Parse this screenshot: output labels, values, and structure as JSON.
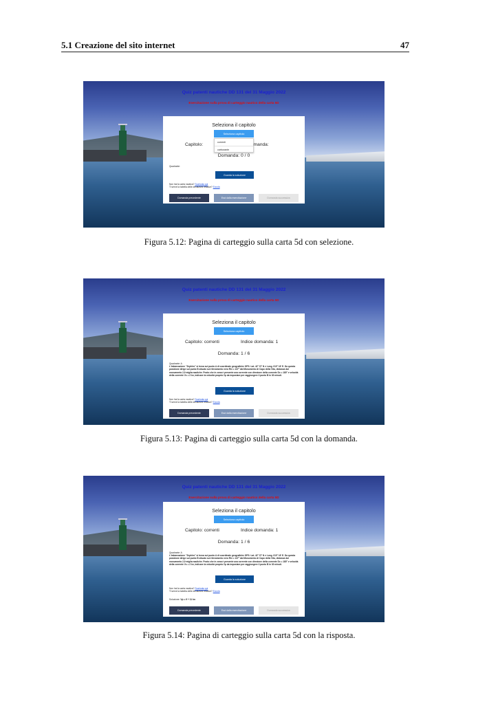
{
  "page": {
    "section": "5.1 Creazione del sito internet",
    "number": "47"
  },
  "app": {
    "title": "Quiz patenti nautiche DD 131 del 31 Maggio 2022",
    "subtitle": "Esercitazione sulla prova di carteggio nautico della carta 5D",
    "panel_title": "Seleziona il capitolo",
    "select_button": "Seleziona capitolo",
    "answer_button": "Guarda la soluzione",
    "help_line1": "Non hai la carta nautica?",
    "help_link1": "Scaricala qui",
    "help_line2": "Ti serve la tabella delle deviazioni residue?",
    "help_link2": "Eccola",
    "nav_prev": "Domanda precedente",
    "nav_exit": "Esci dalla esercitazione",
    "nav_next": "Domanda successiva"
  },
  "figures": [
    {
      "caption": "Figura 5.12: Pagina di carteggio sulla carta 5d con selezione.",
      "capitolo_partial": "Capitolo:",
      "indice_partial": "omanda:",
      "counter": "Domanda: 0 / 0",
      "question_label": "Quadrante:",
      "dropdown": [
        "correnti",
        "carburante"
      ]
    },
    {
      "caption": "Figura 5.13: Pagina di carteggio sulla carta 5d con la domanda.",
      "capitolo": "Capitolo: correnti",
      "indice": "Indice domanda: 1",
      "counter": "Domanda: 1 / 6",
      "question_label": "Quadrante: A",
      "question_body": "L'imbarcazione \"Zephiro\" si trova sul punto A di coordinate geografiche GPS: Lat. 42° 37' N e Long. 010° 16' E. Da questa posizione dirige sul punto B situato sul rilevamento vero Rlv = 137° dal Monumento di Capo della Vita, distanza dal monumento 2,9 miglia nautiche. Posto che in zona è presente una corrente con direzione della corrente Dc = 180° e velocità della corrente Vc = 2 kn, indicare la velocità propria Vp da impostare per raggiungere il punto B in 30 minuti."
    },
    {
      "caption": "Figura 5.14: Pagina di carteggio sulla carta 5d con la risposta.",
      "capitolo": "Capitolo: correnti",
      "indice": "Indice domanda: 1",
      "counter": "Domanda: 1 / 6",
      "question_label": "Quadrante: A",
      "question_body": "L'imbarcazione \"Zephiro\" si trova sul punto A di coordinate geografiche GPS: Lat. 42° 37' N e Long. 010° 16' E. Da questa posizione dirige sul punto B situato sul rilevamento vero Rlv = 137° dal Monumento di Capo della Vita, distanza dal monumento 2,9 miglia nautiche. Posto che in zona è presente una corrente con direzione della corrente Dc = 180° e velocità della corrente Vc = 2 kn, indicare la velocità propria Vp da impostare per raggiungere il punto B in 30 minuti.",
      "solution_label": "Soluzione:",
      "solution_value": "Vp = 9 ÷ 11 kn"
    }
  ]
}
